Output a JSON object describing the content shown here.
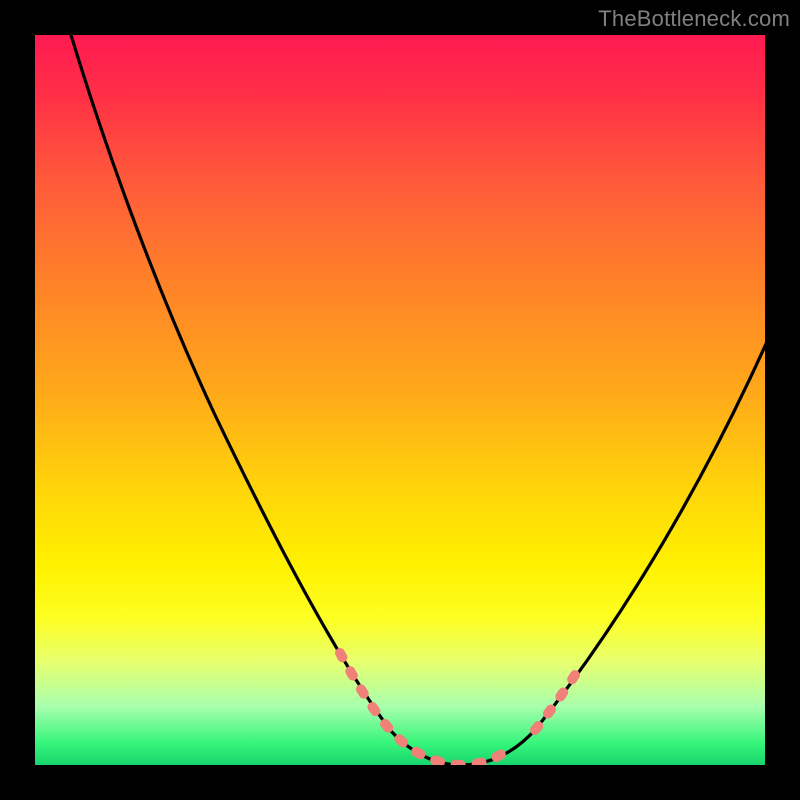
{
  "watermark": "TheBottleneck.com",
  "colors": {
    "background": "#000000",
    "gradient_top": "#ff1a52",
    "gradient_mid": "#fff200",
    "gradient_bottom": "#18d46e",
    "curve": "#000000",
    "marker": "#ef8178"
  },
  "chart_data": {
    "type": "line",
    "title": "",
    "xlabel": "",
    "ylabel": "",
    "xlim": [
      0,
      100
    ],
    "ylim": [
      0,
      100
    ],
    "series": [
      {
        "name": "bottleneck-curve",
        "x": [
          5,
          10,
          15,
          20,
          25,
          30,
          35,
          40,
          45,
          50,
          55,
          60,
          65,
          70,
          75,
          80,
          85,
          90,
          95,
          100
        ],
        "values": [
          100,
          92,
          82,
          71,
          60,
          48,
          36,
          24,
          13,
          5,
          1,
          0,
          2,
          8,
          15,
          23,
          32,
          41,
          51,
          61
        ]
      }
    ],
    "annotations": [
      {
        "name": "highlight-band-left",
        "x_range": [
          41,
          52
        ],
        "style": "dotted",
        "color": "#ef8178"
      },
      {
        "name": "highlight-band-right",
        "x_range": [
          61,
          72
        ],
        "style": "dotted",
        "color": "#ef8178"
      }
    ],
    "minimum": {
      "x": 58,
      "y": 0
    }
  }
}
